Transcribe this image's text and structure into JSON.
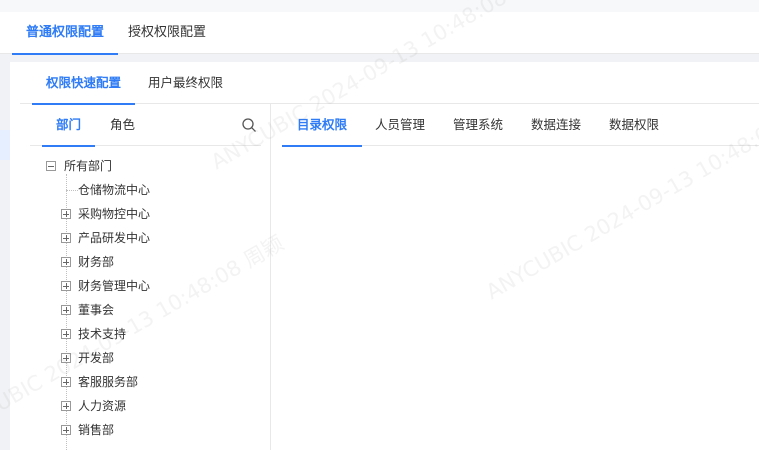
{
  "top_tabs": [
    {
      "label": "普通权限配置",
      "active": true
    },
    {
      "label": "授权权限配置",
      "active": false
    }
  ],
  "sub_tabs": [
    {
      "label": "权限快速配置",
      "active": true
    },
    {
      "label": "用户最终权限",
      "active": false
    }
  ],
  "left_panel": {
    "tabs": [
      {
        "label": "部门",
        "active": true
      },
      {
        "label": "角色",
        "active": false
      }
    ],
    "search_icon": "search-icon",
    "tree": {
      "root": {
        "label": "所有部门",
        "expanded": true
      },
      "children": [
        {
          "label": "仓储物流中心",
          "expandable": false
        },
        {
          "label": "采购物控中心",
          "expandable": true
        },
        {
          "label": "产品研发中心",
          "expandable": true
        },
        {
          "label": "财务部",
          "expandable": true
        },
        {
          "label": "财务管理中心",
          "expandable": true
        },
        {
          "label": "董事会",
          "expandable": true
        },
        {
          "label": "技术支持",
          "expandable": true
        },
        {
          "label": "开发部",
          "expandable": true
        },
        {
          "label": "客服服务部",
          "expandable": true
        },
        {
          "label": "人力资源",
          "expandable": true
        },
        {
          "label": "销售部",
          "expandable": true
        }
      ]
    }
  },
  "right_panel": {
    "tabs": [
      {
        "label": "目录权限",
        "active": true
      },
      {
        "label": "人员管理",
        "active": false
      },
      {
        "label": "管理系统",
        "active": false
      },
      {
        "label": "数据连接",
        "active": false
      },
      {
        "label": "数据权限",
        "active": false
      }
    ]
  },
  "watermark": "ANYCUBIC 2024-09-13 10:48:08 周颖",
  "colors": {
    "accent": "#2f7cf6"
  }
}
